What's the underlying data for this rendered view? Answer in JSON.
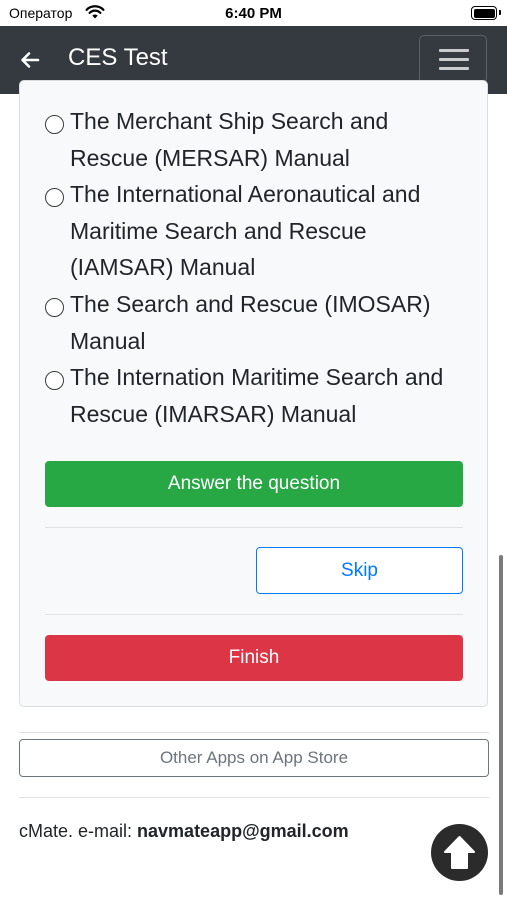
{
  "status_bar": {
    "carrier": "Оператор",
    "time": "6:40 PM"
  },
  "navbar": {
    "title": "CES Test"
  },
  "question": {
    "options": [
      {
        "line1": "The Merchant Ship Search and",
        "rest": "Rescue (MERSAR) Manual"
      },
      {
        "line1": "The International Aeronautical and",
        "rest": "Maritime Search and Rescue (IAMSAR) Manual"
      },
      {
        "line1": "The Search and Rescue (IMOSAR)",
        "rest": "Manual"
      },
      {
        "line1": "The Internation Maritime Search and",
        "rest": "Rescue (IMARSAR) Manual"
      }
    ]
  },
  "actions": {
    "answer_label": "Answer the question",
    "skip_label": "Skip",
    "finish_label": "Finish"
  },
  "footer": {
    "other_apps_label": "Other Apps on App Store",
    "contact_prefix": "cMate. e-mail: ",
    "email": "navmateapp@gmail.com"
  }
}
